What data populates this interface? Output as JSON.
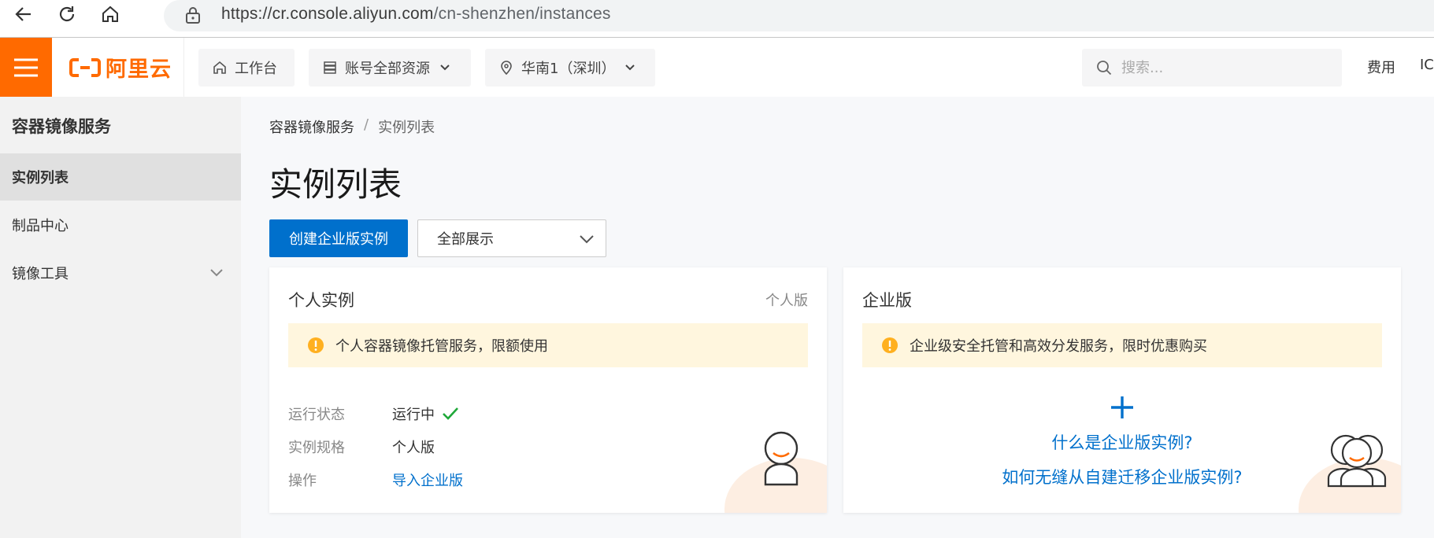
{
  "browser": {
    "url_host": "https://cr.console.aliyun.com",
    "url_path": "/cn-shenzhen/instances",
    "icons": [
      "back-arrow-icon",
      "reload-icon",
      "home-icon",
      "lock-icon"
    ]
  },
  "topbar": {
    "logo_text": "阿里云",
    "workbench_label": "工作台",
    "resources_label": "账号全部资源",
    "region_label": "华南1（深圳）",
    "search_placeholder": "搜索...",
    "fees_label": "费用",
    "icp_label": "IC",
    "brand_color": "#ff6a00"
  },
  "sidebar": {
    "title": "容器镜像服务",
    "items": [
      {
        "label": "实例列表",
        "active": true
      },
      {
        "label": "制品中心",
        "active": false
      },
      {
        "label": "镜像工具",
        "active": false,
        "expandable": true
      }
    ]
  },
  "main": {
    "breadcrumb": {
      "root": "容器镜像服务",
      "separator": "/",
      "current": "实例列表"
    },
    "page_title": "实例列表",
    "create_button": "创建企业版实例",
    "filter_select": "全部展示",
    "accent_color": "#0070cc",
    "personal_card": {
      "title": "个人实例",
      "tag": "个人版",
      "notice": "个人容器镜像托管服务，限额使用",
      "rows": [
        {
          "key": "运行状态",
          "value": "运行中"
        },
        {
          "key": "实例规格",
          "value": "个人版"
        },
        {
          "key": "操作",
          "value": "导入企业版"
        }
      ]
    },
    "enterprise_card": {
      "title": "企业版",
      "notice": "企业级安全托管和高效分发服务，限时优惠购买",
      "link_what": "什么是企业版实例?",
      "link_migrate": "如何无缝从自建迁移企业版实例?"
    }
  }
}
